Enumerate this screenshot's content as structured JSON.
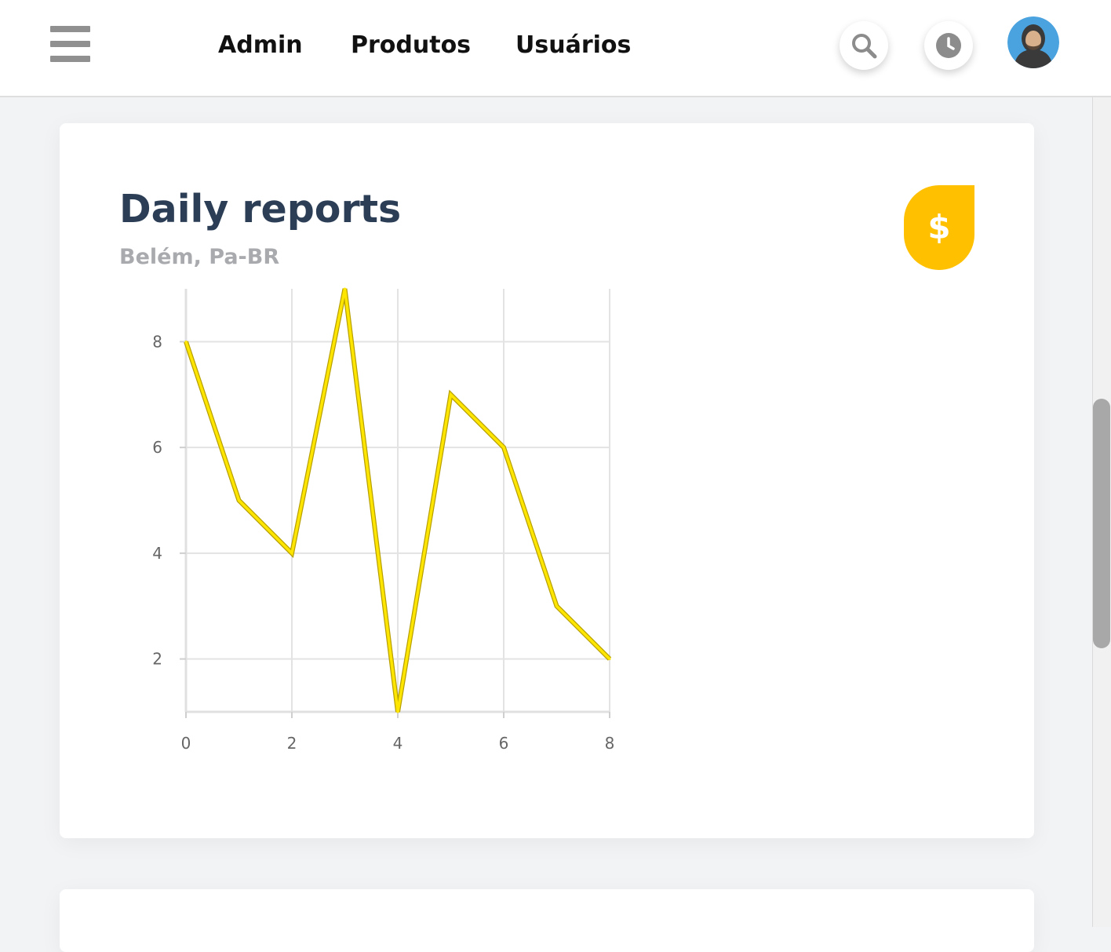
{
  "header": {
    "nav": [
      {
        "label": "Admin"
      },
      {
        "label": "Produtos"
      },
      {
        "label": "Usuários"
      }
    ],
    "icons": {
      "menu": "hamburger-menu-icon",
      "search": "search-icon",
      "history": "clock-icon",
      "user": "avatar"
    }
  },
  "card": {
    "title": "Daily reports",
    "subtitle": "Belém, Pa-BR",
    "badge_icon": "dollar-icon",
    "badge_glyph": "$",
    "badge_color": "#ffc000"
  },
  "chart_data": {
    "type": "line",
    "x": [
      0,
      1,
      2,
      3,
      4,
      5,
      6,
      7,
      8
    ],
    "y": [
      8,
      5,
      4,
      9,
      1,
      7,
      6,
      3,
      2
    ],
    "xlim": [
      0,
      8
    ],
    "ylim": [
      1,
      9
    ],
    "xticks": [
      "0",
      "2",
      "4",
      "6",
      "8"
    ],
    "yticks": [
      "2",
      "4",
      "6",
      "8"
    ],
    "grid": true,
    "line_color": "#ffe600",
    "title": "",
    "xlabel": "",
    "ylabel": ""
  }
}
